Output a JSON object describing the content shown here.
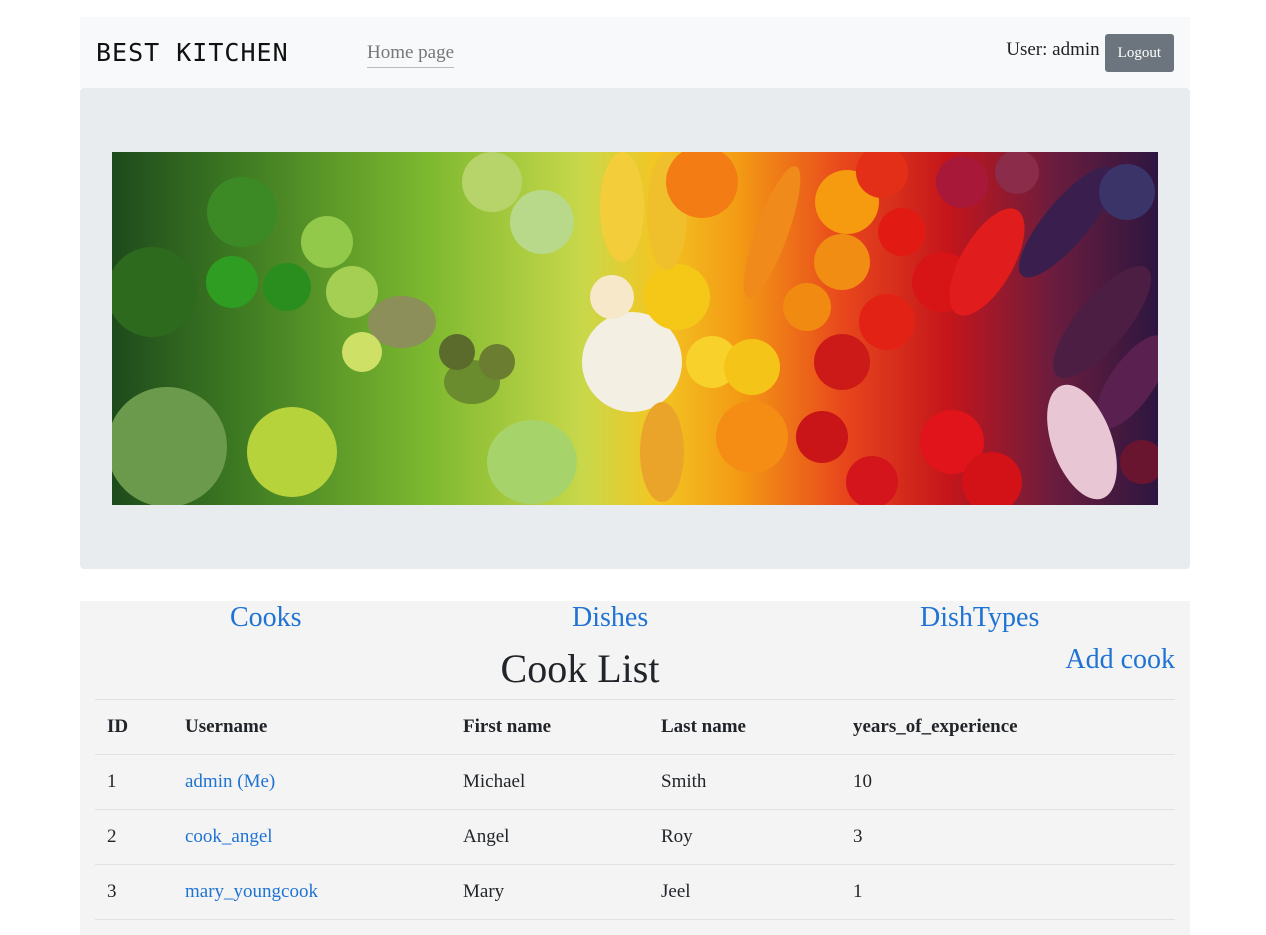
{
  "navbar": {
    "brand": "BEST KITCHEN",
    "home_link": "Home page",
    "user_label": "User: admin",
    "logout_label": "Logout"
  },
  "hero": {
    "image_icon": "vegetables-banner-image"
  },
  "sections": {
    "cooks": "Cooks",
    "dishes": "Dishes",
    "dish_types": "DishTypes"
  },
  "main": {
    "title": "Cook List",
    "add_link": "Add cook",
    "table": {
      "headers": [
        "ID",
        "Username",
        "First name",
        "Last name",
        "years_of_experience"
      ],
      "rows": [
        {
          "id": "1",
          "username": "admin (Me)",
          "first_name": "Michael",
          "last_name": "Smith",
          "years": "10"
        },
        {
          "id": "2",
          "username": "cook_angel",
          "first_name": "Angel",
          "last_name": "Roy",
          "years": "3"
        },
        {
          "id": "3",
          "username": "mary_youngcook",
          "first_name": "Mary",
          "last_name": "Jeel",
          "years": "1"
        }
      ]
    }
  },
  "colors": {
    "link": "#1f73d3",
    "navbar_bg": "#f8f9fa",
    "jumbotron_bg": "#e9ecef",
    "button_bg": "#6c757d"
  }
}
